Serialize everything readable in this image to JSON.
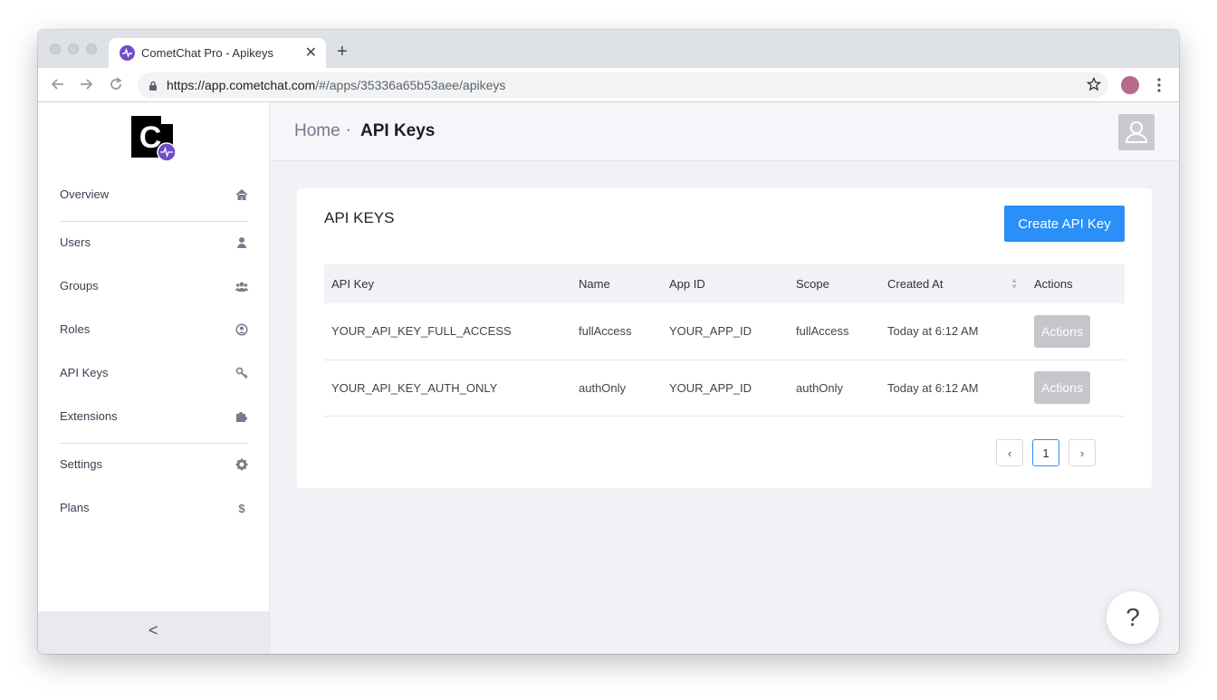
{
  "browser": {
    "tab_title": "CometChat Pro - Apikeys",
    "close_glyph": "✕",
    "new_tab_glyph": "+",
    "url_host": "https://app.cometchat.com",
    "url_path": "/#/apps/35336a65b53aee/apikeys"
  },
  "sidebar": {
    "logo_letter": "C",
    "items": [
      {
        "label": "Overview",
        "icon": "home-icon"
      },
      {
        "label": "Users",
        "icon": "user-icon"
      },
      {
        "label": "Groups",
        "icon": "users-group-icon"
      },
      {
        "label": "Roles",
        "icon": "user-circle-icon"
      },
      {
        "label": "API Keys",
        "icon": "key-icon"
      },
      {
        "label": "Extensions",
        "icon": "puzzle-icon"
      },
      {
        "label": "Settings",
        "icon": "gear-icon"
      },
      {
        "label": "Plans",
        "icon": "dollar-icon"
      }
    ],
    "collapse_glyph": "<"
  },
  "breadcrumb": {
    "home": "Home",
    "separator": "·",
    "current": "API Keys"
  },
  "card": {
    "title": "API KEYS",
    "create_button": "Create API Key"
  },
  "table": {
    "headers": [
      "API Key",
      "Name",
      "App ID",
      "Scope",
      "Created At",
      "Actions"
    ],
    "rows": [
      {
        "api_key": "YOUR_API_KEY_FULL_ACCESS",
        "name": "fullAccess",
        "app_id": "YOUR_APP_ID",
        "scope": "fullAccess",
        "created_at": "Today at 6:12 AM",
        "action": "Actions"
      },
      {
        "api_key": "YOUR_API_KEY_AUTH_ONLY",
        "name": "authOnly",
        "app_id": "YOUR_APP_ID",
        "scope": "authOnly",
        "created_at": "Today at 6:12 AM",
        "action": "Actions"
      }
    ]
  },
  "pagination": {
    "prev": "‹",
    "current_page": "1",
    "next": "›"
  },
  "help_glyph": "?",
  "colors": {
    "primary": "#2a8ff7",
    "brand_purple": "#6f4ec6"
  }
}
